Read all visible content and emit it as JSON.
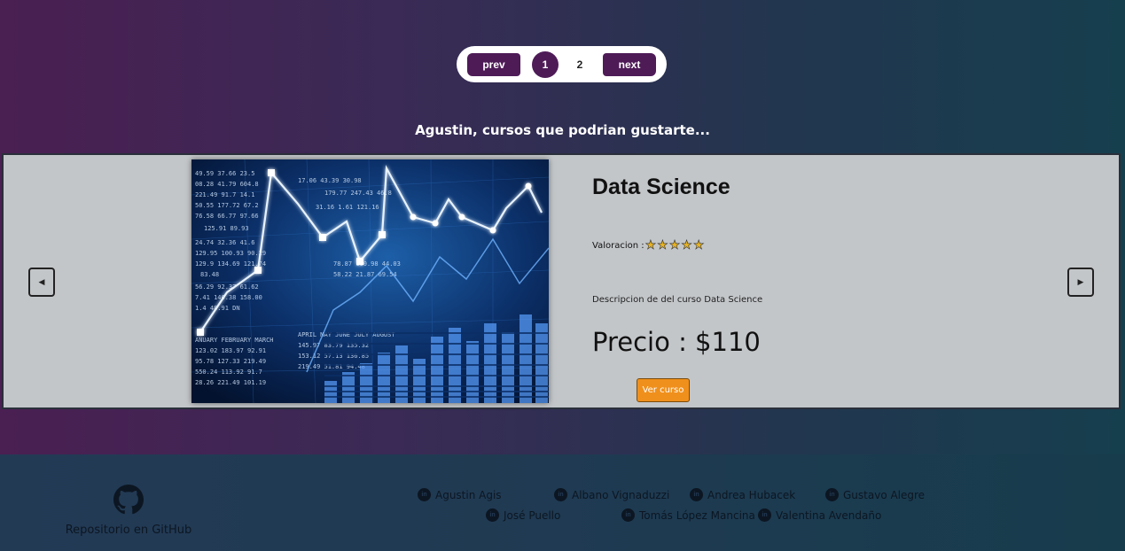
{
  "pagination": {
    "prev_label": "prev",
    "pages": [
      "1",
      "2"
    ],
    "current_page": "1",
    "next_label": "next"
  },
  "recommendations": {
    "heading": "Agustin, cursos que podrian gustarte..."
  },
  "course": {
    "title": "Data Science",
    "rating_label": "Valoracion :",
    "rating": 5,
    "rating_max": 5,
    "description": "Descripcion de del curso Data Science",
    "price": "Precio : $110",
    "view_button": "Ver curso",
    "image": "stock-market-chart-image"
  },
  "carousel": {
    "prev_icon": "triangle-left-icon",
    "next_icon": "triangle-right-icon"
  },
  "footer": {
    "github_label": "Repositorio en GitHub",
    "github_icon": "github-icon",
    "members": [
      "Agustin Agis",
      "Albano Vignaduzzi",
      "Andrea Hubacek",
      "Gustavo Alegre",
      "José Puello",
      "Tomás López Mancina",
      "Valentina Avendaño"
    ],
    "member_icon": "linkedin-icon"
  },
  "colors": {
    "accent": "#4e1b57",
    "button_orange": "#f0901c",
    "card_bg": "#c3c6c9",
    "star": "#e8b321"
  }
}
